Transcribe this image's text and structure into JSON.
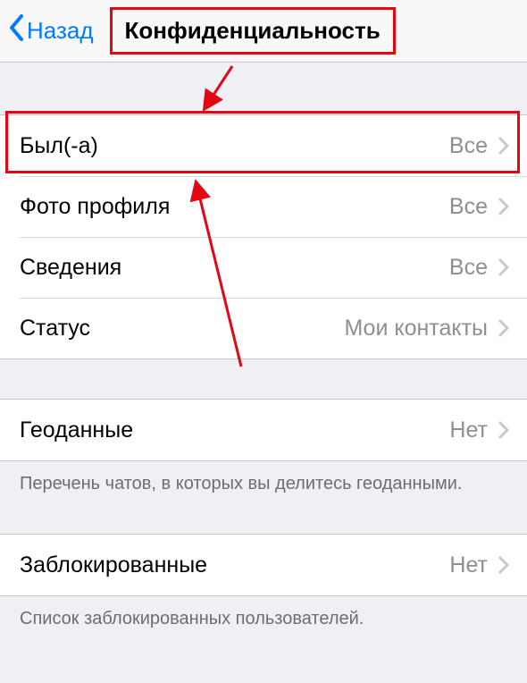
{
  "nav": {
    "back_label": "Назад",
    "title": "Конфиденциальность"
  },
  "group1": {
    "rows": [
      {
        "label": "Был(-а)",
        "value": "Все"
      },
      {
        "label": "Фото профиля",
        "value": "Все"
      },
      {
        "label": "Сведения",
        "value": "Все"
      },
      {
        "label": "Статус",
        "value": "Мои контакты"
      }
    ]
  },
  "group2": {
    "rows": [
      {
        "label": "Геоданные",
        "value": "Нет"
      }
    ],
    "footer": "Перечень чатов, в которых вы делитесь геоданными."
  },
  "group3": {
    "rows": [
      {
        "label": "Заблокированные",
        "value": "Нет"
      }
    ],
    "footer": "Список заблокированных пользователей."
  }
}
